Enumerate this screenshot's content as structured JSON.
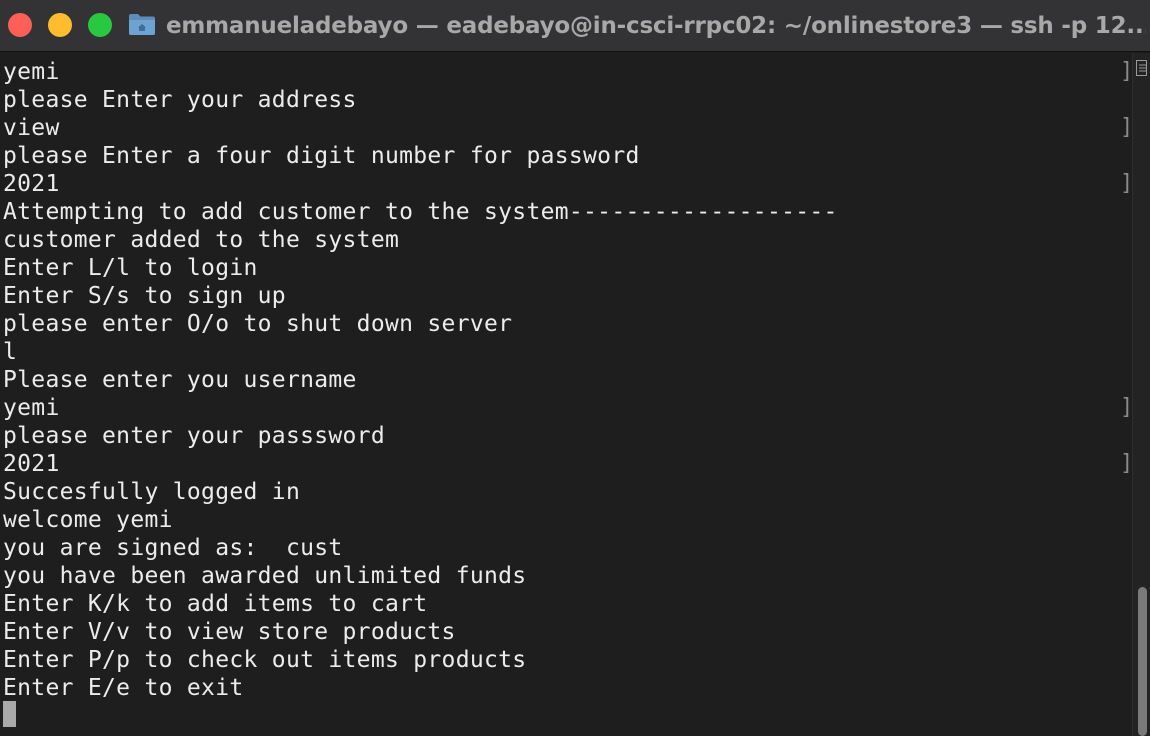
{
  "window": {
    "title": "emmanueladebayo — eadebayo@in-csci-rrpc02: ~/onlinestore3 — ssh -p 12...",
    "traffic_lights": {
      "close_color": "#fe5f57",
      "minimize_color": "#febc2e",
      "zoom_color": "#28c840"
    },
    "folder_icon": "folder-icon"
  },
  "terminal": {
    "lines": [
      "yemi",
      "please Enter your address",
      "view",
      "please Enter a four digit number for password",
      "2021",
      "Attempting to add customer to the system-------------------",
      "customer added to the system",
      "Enter L/l to login",
      "Enter S/s to sign up",
      "please enter O/o to shut down server",
      "l",
      "Please enter you username",
      "yemi",
      "please enter your passsword",
      "2021",
      "Succesfully logged in",
      "welcome yemi",
      "you are signed as:  cust",
      "you have been awarded unlimited funds",
      "Enter K/k to add items to cart",
      "Enter V/v to view store products",
      "Enter P/p to check out items products",
      "Enter E/e to exit"
    ],
    "input_markers": [
      "]",
      "]",
      "]",
      "]",
      "]"
    ],
    "colors": {
      "background": "#1e1e1e",
      "text": "#ececec",
      "cursor": "#a9a9a9"
    }
  }
}
